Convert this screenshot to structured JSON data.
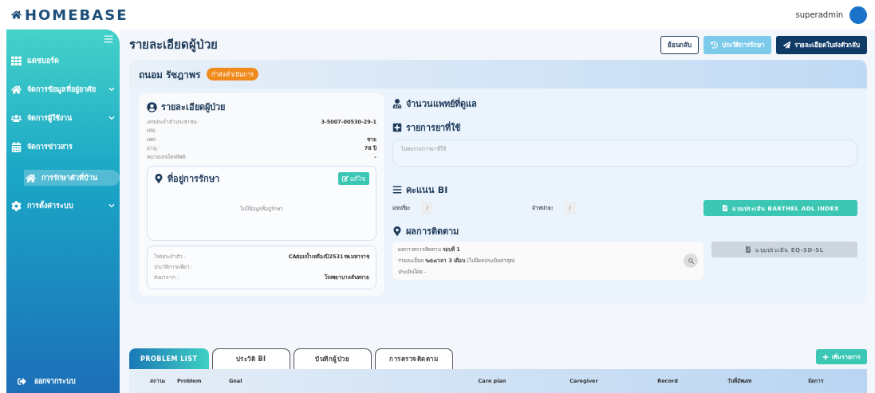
{
  "header": {
    "logo": "HOMEBASE",
    "user": "superadmin"
  },
  "sidebar": {
    "items": [
      {
        "label": "แดชบอร์ด",
        "expandable": false,
        "selected": false
      },
      {
        "label": "จัดการข้อมูลที่อยู่อาศัย",
        "expandable": true,
        "selected": false
      },
      {
        "label": "จัดการผู้ใช้งาน",
        "expandable": true,
        "selected": false
      },
      {
        "label": "จัดการข่าวสาร",
        "expandable": false,
        "selected": false
      },
      {
        "label": "การรักษาตัวที่บ้าน",
        "expandable": false,
        "selected": true
      },
      {
        "label": "การตั้งค่าระบบ",
        "expandable": true,
        "selected": false
      }
    ],
    "logout": "ออกจากระบบ"
  },
  "page_title": "รายละเอียดผู้ป่วย",
  "actions": [
    {
      "label": "ย้อนกลับ",
      "kind": "outline"
    },
    {
      "label": "ประวัติการรักษา",
      "kind": "light"
    },
    {
      "label": "รายละเอียดใบส่งตัวกลับ",
      "kind": "dark"
    }
  ],
  "patient": {
    "name": "ถนอม รัชฎาพร",
    "status": "กำลังดำเนินการ"
  },
  "details": {
    "title": "รายละเอียดผู้ป่วย",
    "fields": [
      {
        "label": "เลขประจำตัวประชาชน:",
        "value": "3-5007-00530-29-1"
      },
      {
        "label": "HN:"
      },
      {
        "label": "เพศ:",
        "value": "ชาย"
      },
      {
        "label": "อายุ:",
        "value": "78 ปี"
      },
      {
        "label": "หมายเลขโทรศัพท์:",
        "value": "-"
      }
    ],
    "address": {
      "title": "ที่อยู่การรักษา",
      "edit": "แก้ไข",
      "empty": "ไม่มีข้อมูลที่อยู่รักษา"
    },
    "medical": [
      {
        "label": "โรคประจำตัว :",
        "value": "CAต่อมน้ำเหลืองปี2531รพ.มหาราช"
      },
      {
        "label": "ประวัติการแพ้ยา:"
      },
      {
        "label": "ส่งมาจาก :",
        "value": "โรงพยาบาลสันทราย"
      }
    ]
  },
  "doctors": {
    "title": "จำนวนแพทย์ที่ดูแล"
  },
  "medications": {
    "title": "รายการยาที่ใช้",
    "empty": "ไม่พบรายการยาที่ใช้"
  },
  "bi": {
    "title": "คะแนน BI",
    "fields": [
      {
        "label": "แรกเริ่ม:",
        "value": "/"
      },
      {
        "label": "จำหน่าย:",
        "value": "/"
      }
    ],
    "button": {
      "label": "แบบประเมิน BARTHEL ADL INDEX",
      "disabled": false
    }
  },
  "followup": {
    "title": "ผลการติดตาม",
    "lines": [
      "ผลการตรวจติดตาม **รอบที่ 1**",
      "รายละเอียด **ระยะเวลา 3 เดือน** (ไม่มีผลประเมินล่าสุด)",
      "ประเมินโดย -"
    ],
    "button": {
      "label": "แบบประเมิน EQ-5D-5L",
      "disabled": true
    }
  },
  "tabs": [
    {
      "label": "PROBLEM LIST",
      "selected": true
    },
    {
      "label": "ประวัติ BI",
      "selected": false
    },
    {
      "label": "บันทึกผู้ป่วย",
      "selected": false
    },
    {
      "label": "การตรวจติดตาม",
      "selected": false
    }
  ],
  "add_button": "เพิ่มรายการ",
  "table": {
    "columns": [
      "สถานะ",
      "Problem",
      "Goal",
      "Care plan",
      "Caregiver",
      "Record",
      "วันที่อัพเดท",
      "จัดการ"
    ]
  }
}
